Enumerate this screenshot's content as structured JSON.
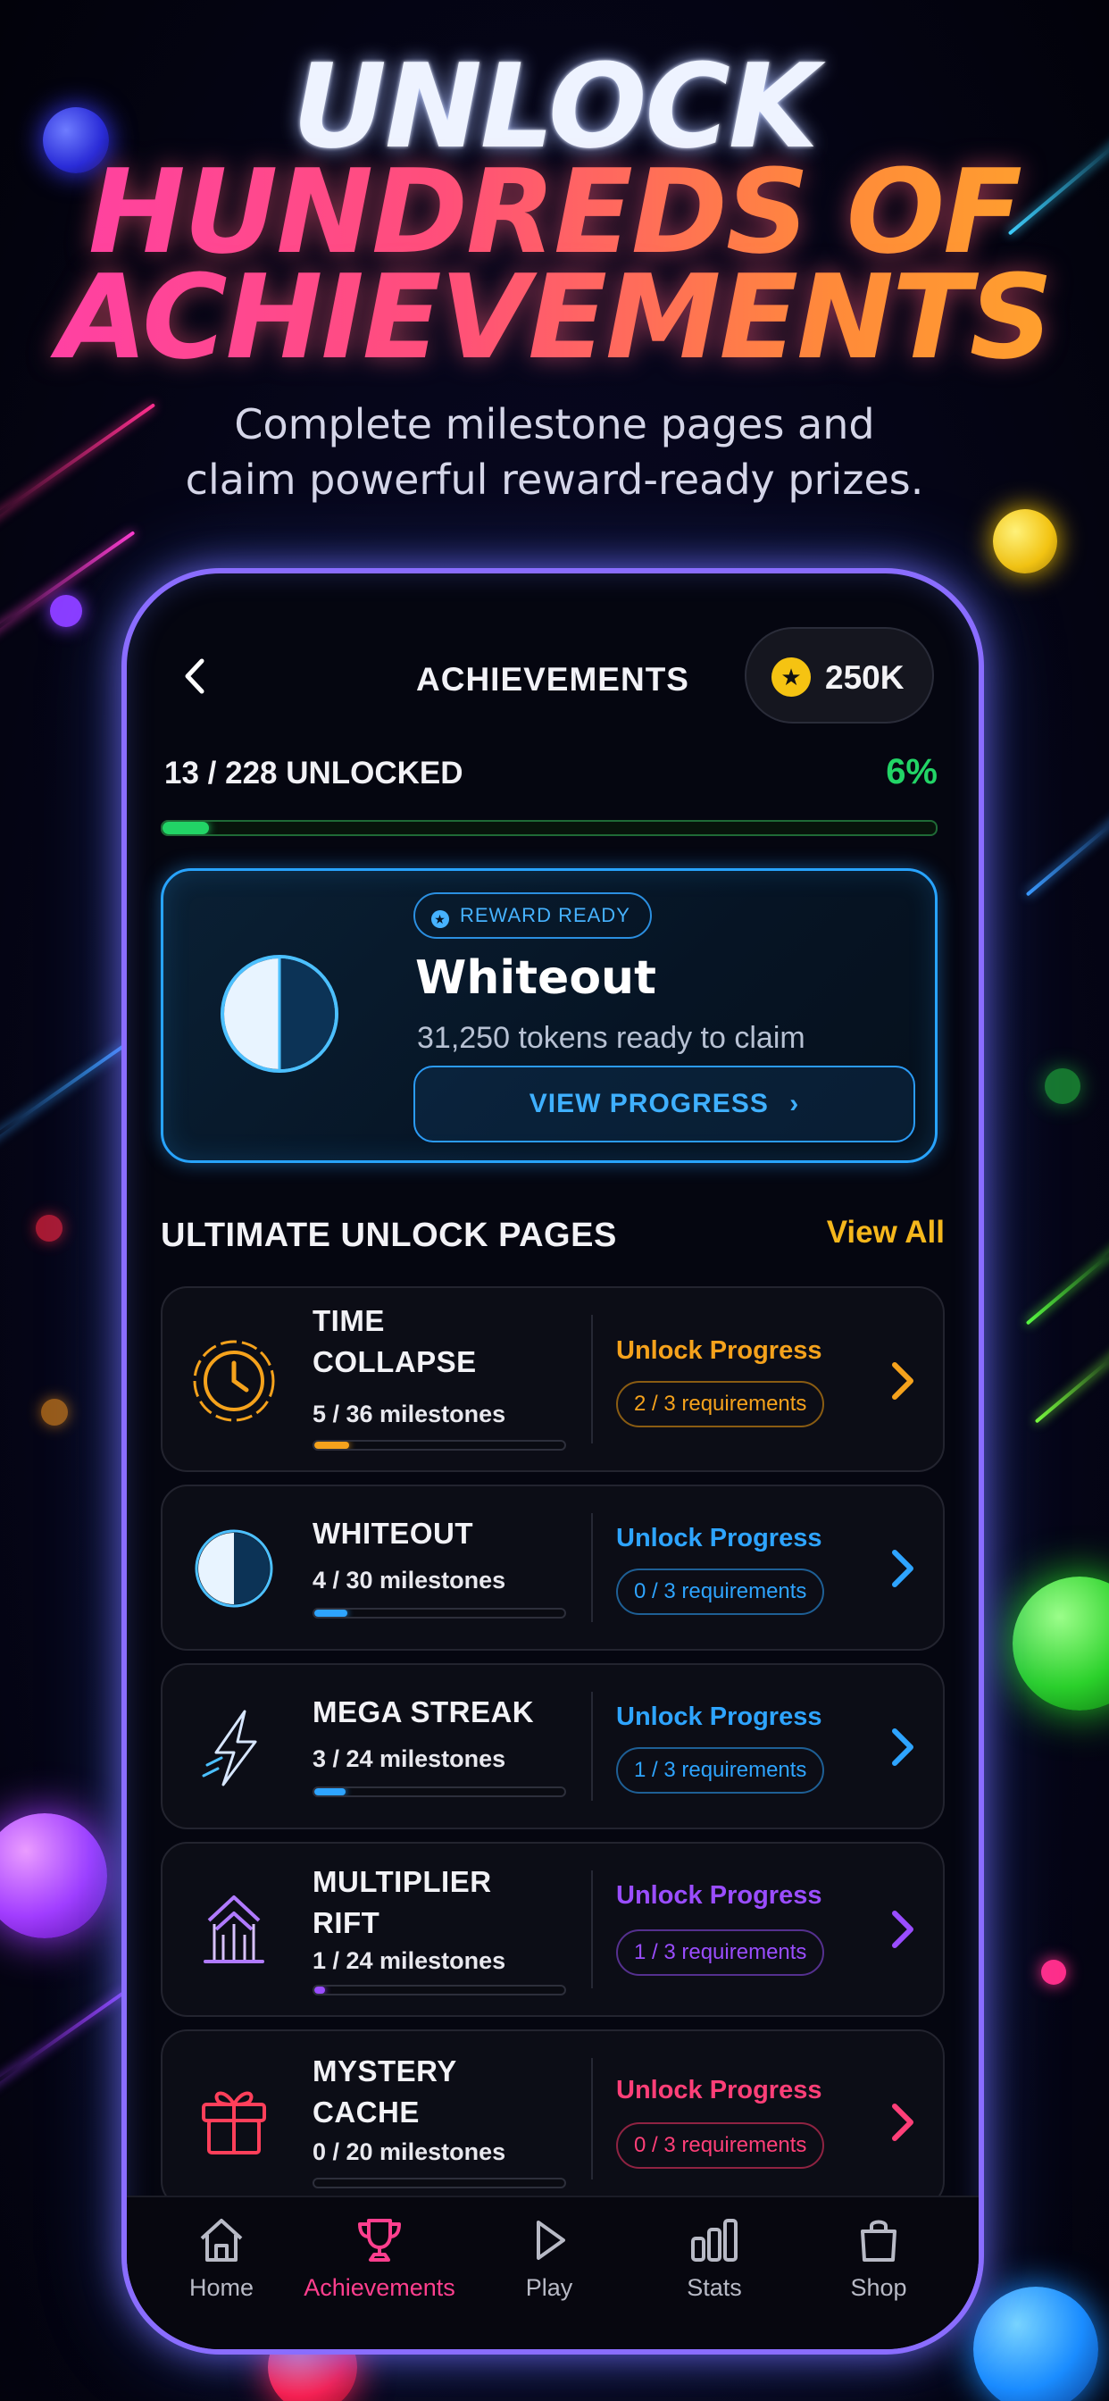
{
  "headline": {
    "line1": "UNLOCK",
    "line2": "HUNDREDS OF",
    "line3": "ACHIEVEMENTS",
    "subtitle_line1": "Complete milestone pages and",
    "subtitle_line2": "claim powerful reward-ready prizes."
  },
  "topbar": {
    "back_icon": "chevron-left-icon",
    "title": "ACHIEVEMENTS",
    "coin_icon": "star-coin-icon",
    "coins": "250K"
  },
  "progress": {
    "unlocked_text": "13 / 228 UNLOCKED",
    "percent_text": "6%",
    "fraction": 0.06
  },
  "reward": {
    "badge": "REWARD READY",
    "title": "Whiteout",
    "subtitle": "31,250 tokens ready to claim",
    "button": "VIEW PROGRESS",
    "icon": "half-moon-icon"
  },
  "section": {
    "title": "ULTIMATE UNLOCK PAGES",
    "view_all": "View All"
  },
  "pages": [
    {
      "line1": "TIME",
      "line2": "COLLAPSE",
      "milestones": "5 / 36 milestones",
      "fraction": 0.139,
      "label": "Unlock Progress",
      "requirements": "2 / 3 requirements",
      "color": "#f5a21c",
      "icon": "clock-icon"
    },
    {
      "line1": "WHITEOUT",
      "line2": "",
      "milestones": "4 / 30 milestones",
      "fraction": 0.133,
      "label": "Unlock Progress",
      "requirements": "0 / 3 requirements",
      "color": "#2ea4ff",
      "icon": "half-moon-icon"
    },
    {
      "line1": "MEGA STREAK",
      "line2": "",
      "milestones": "3 / 24 milestones",
      "fraction": 0.125,
      "label": "Unlock Progress",
      "requirements": "1 / 3 requirements",
      "color": "#2ea4ff",
      "icon": "lightning-icon"
    },
    {
      "line1": "MULTIPLIER",
      "line2": "RIFT",
      "milestones": "1 / 24 milestones",
      "fraction": 0.042,
      "label": "Unlock Progress",
      "requirements": "1 / 3 requirements",
      "color": "#9a4dff",
      "icon": "rift-chevrons-icon"
    },
    {
      "line1": "MYSTERY",
      "line2": "CACHE",
      "milestones": "0 / 20 milestones",
      "fraction": 0.0,
      "label": "Unlock Progress",
      "requirements": "0 / 3 requirements",
      "color": "#ff3f78",
      "icon": "gift-icon"
    }
  ],
  "tabs": [
    {
      "label": "Home",
      "icon": "home-icon",
      "active": false
    },
    {
      "label": "Achievements",
      "icon": "trophy-icon",
      "active": true
    },
    {
      "label": "Play",
      "icon": "play-icon",
      "active": false
    },
    {
      "label": "Stats",
      "icon": "bar-chart-icon",
      "active": false
    },
    {
      "label": "Shop",
      "icon": "shopping-bag-icon",
      "active": false
    }
  ],
  "colors": {
    "accent_green": "#22d466",
    "accent_blue": "#2ea4ff",
    "accent_gold": "#f5b71c",
    "accent_pink": "#ff3f8e"
  }
}
